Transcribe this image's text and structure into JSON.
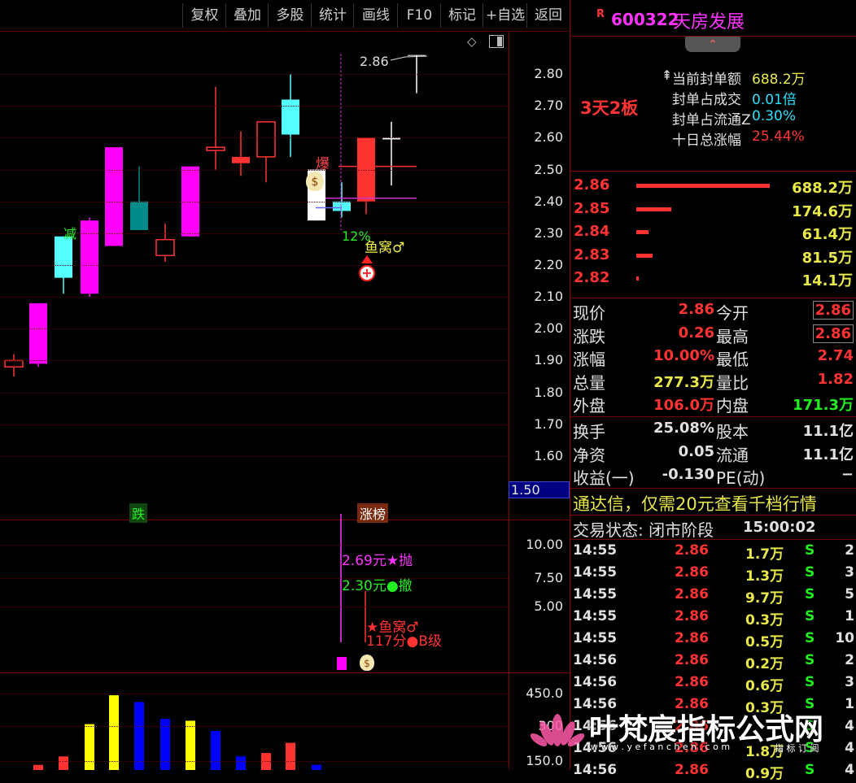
{
  "toolbar": {
    "buttons": [
      "复权",
      "叠加",
      "多股",
      "统计",
      "画线",
      "F10",
      "标记",
      "+自选",
      "返回"
    ]
  },
  "header": {
    "badge": "R",
    "code": "600322",
    "name": "天房发展",
    "collapse_glyph": "⌃"
  },
  "board_label": "3天2板",
  "seal_stats": [
    {
      "label": "当前封单额",
      "value": "688.2万",
      "prefix": "⇞"
    },
    {
      "label": "封单占成交",
      "value": "0.01倍"
    },
    {
      "label": "封单占流通Z",
      "value": "0.30%"
    },
    {
      "label": "十日总涨幅",
      "value": "25.44%"
    }
  ],
  "order_book": [
    {
      "price": "2.86",
      "volume": "688.2万",
      "bar": 1.0
    },
    {
      "price": "2.85",
      "volume": "174.6万",
      "bar": 0.26
    },
    {
      "price": "2.84",
      "volume": "61.4万",
      "bar": 0.09
    },
    {
      "price": "2.83",
      "volume": "81.5万",
      "bar": 0.12
    },
    {
      "price": "2.82",
      "volume": "14.1万",
      "bar": 0.02
    }
  ],
  "quote": [
    {
      "l1": "现价",
      "v1": "2.86",
      "c1": "red",
      "l2": "今开",
      "v2": "2.86",
      "c2": "red",
      "boxed": true
    },
    {
      "l1": "涨跌",
      "v1": "0.26",
      "c1": "red",
      "l2": "最高",
      "v2": "2.86",
      "c2": "red",
      "boxed": true
    },
    {
      "l1": "涨幅",
      "v1": "10.00%",
      "c1": "red",
      "l2": "最低",
      "v2": "2.74",
      "c2": "red",
      "boxed": false
    },
    {
      "l1": "总量",
      "v1": "277.3万",
      "c1": "yel",
      "l2": "量比",
      "v2": "1.82",
      "c2": "red",
      "boxed": false
    },
    {
      "l1": "外盘",
      "v1": "106.0万",
      "c1": "red",
      "l2": "内盘",
      "v2": "171.3万",
      "c2": "grn",
      "boxed": false
    }
  ],
  "fundamentals": [
    {
      "l1": "换手",
      "v1": "25.08%",
      "l2": "股本",
      "v2": "11.1亿"
    },
    {
      "l1": "净资",
      "v1": "0.05",
      "l2": "流通",
      "v2": "11.1亿"
    },
    {
      "l1": "收益(一)",
      "v1": "-0.130",
      "l2": "PE(动)",
      "v2": "−"
    }
  ],
  "promo": "通达信，仅需20元查看千档行情",
  "trade_status": {
    "label": "交易状态: 闭市阶段",
    "time": "15:00:02"
  },
  "ticks": [
    {
      "t": "14:55",
      "p": "2.86",
      "v": "1.7万",
      "s": "S",
      "n": "2"
    },
    {
      "t": "14:55",
      "p": "2.86",
      "v": "1.3万",
      "s": "S",
      "n": "3"
    },
    {
      "t": "14:55",
      "p": "2.86",
      "v": "9.7万",
      "s": "S",
      "n": "5"
    },
    {
      "t": "14:55",
      "p": "2.86",
      "v": "0.3万",
      "s": "S",
      "n": "1"
    },
    {
      "t": "14:55",
      "p": "2.86",
      "v": "0.5万",
      "s": "S",
      "n": "10"
    },
    {
      "t": "14:56",
      "p": "2.86",
      "v": "0.2万",
      "s": "S",
      "n": "2"
    },
    {
      "t": "14:56",
      "p": "2.86",
      "v": "0.6万",
      "s": "S",
      "n": "3"
    },
    {
      "t": "14:56",
      "p": "2.86",
      "v": "0.3万",
      "s": "S",
      "n": "1"
    },
    {
      "t": "14:56",
      "p": "2.86",
      "v": "",
      "s": "S",
      "n": "4"
    },
    {
      "t": "14:56",
      "p": "2.86",
      "v": "1.8万",
      "s": "S",
      "n": "4"
    },
    {
      "t": "14:56",
      "p": "2.86",
      "v": "0.9万",
      "s": "S",
      "n": "4"
    }
  ],
  "price_axis": [
    "2.80",
    "2.70",
    "2.60",
    "2.50",
    "2.40",
    "2.30",
    "2.20",
    "2.10",
    "2.00",
    "1.90",
    "1.80",
    "1.70",
    "1.60"
  ],
  "price_axis_box": "1.50",
  "indicator_axis": [
    "10.00",
    "7.50",
    "5.00"
  ],
  "volume_axis": [
    "450.0",
    "300",
    "150.0"
  ],
  "chart_labels": {
    "peak": "2.86",
    "bao": "爆",
    "jian": "减",
    "pct": "12%",
    "yuwo": "鱼窝♂",
    "die_tag": "跌",
    "zhangbang_tag": "涨榜",
    "ind_sell": "2.69元★抛",
    "ind_cancel": "2.30元●撤",
    "ind_yuwo": "★鱼窝♂",
    "ind_score": "117分●B级"
  },
  "watermark": {
    "title": "叶梵宸指标公式网",
    "url": "w w w . y e f a n c h e n . c o m",
    "sub": "指 标 订 阅"
  },
  "chart_data": {
    "type": "candlestick",
    "y_range": [
      1.5,
      2.9
    ],
    "candles": [
      {
        "o": 1.88,
        "h": 1.92,
        "l": 1.85,
        "c": 1.9,
        "color": "red"
      },
      {
        "o": 1.89,
        "h": 2.08,
        "l": 1.88,
        "c": 2.08,
        "color": "magenta"
      },
      {
        "o": 2.16,
        "h": 2.29,
        "l": 2.11,
        "c": 2.29,
        "color": "cyan"
      },
      {
        "o": 2.11,
        "h": 2.35,
        "l": 2.1,
        "c": 2.34,
        "color": "magenta"
      },
      {
        "o": 2.26,
        "h": 2.57,
        "l": 2.26,
        "c": 2.57,
        "color": "magenta"
      },
      {
        "o": 2.4,
        "h": 2.51,
        "l": 2.36,
        "c": 2.31,
        "color": "teal"
      },
      {
        "o": 2.23,
        "h": 2.33,
        "l": 2.21,
        "c": 2.28,
        "color": "red"
      },
      {
        "o": 2.29,
        "h": 2.51,
        "l": 2.29,
        "c": 2.51,
        "color": "magenta"
      },
      {
        "o": 2.56,
        "h": 2.76,
        "l": 2.5,
        "c": 2.57,
        "color": "red"
      },
      {
        "o": 2.54,
        "h": 2.62,
        "l": 2.48,
        "c": 2.52,
        "color": "red"
      },
      {
        "o": 2.54,
        "h": 2.64,
        "l": 2.46,
        "c": 2.65,
        "color": "red"
      },
      {
        "o": 2.61,
        "h": 2.8,
        "l": 2.54,
        "c": 2.72,
        "color": "cyan"
      },
      {
        "o": 2.5,
        "h": 2.5,
        "l": 2.34,
        "c": 2.34,
        "color": "white"
      },
      {
        "o": 2.37,
        "h": 2.46,
        "l": 2.35,
        "c": 2.4,
        "color": "cyan"
      },
      {
        "o": 2.4,
        "h": 2.6,
        "l": 2.36,
        "c": 2.6,
        "color": "red"
      },
      {
        "o": 2.6,
        "h": 2.65,
        "l": 2.45,
        "c": 2.6,
        "color": "white"
      },
      {
        "o": 2.86,
        "h": 2.86,
        "l": 2.74,
        "c": 2.86,
        "color": "white"
      }
    ],
    "volume": [
      {
        "v": 30,
        "color": "red"
      },
      {
        "v": 80,
        "color": "red"
      },
      {
        "v": 270,
        "color": "yellow"
      },
      {
        "v": 440,
        "color": "yellow"
      },
      {
        "v": 400,
        "color": "blue"
      },
      {
        "v": 300,
        "color": "blue"
      },
      {
        "v": 290,
        "color": "yellow"
      },
      {
        "v": 230,
        "color": "blue"
      },
      {
        "v": 80,
        "color": "blue"
      },
      {
        "v": 100,
        "color": "red"
      },
      {
        "v": 160,
        "color": "red"
      },
      {
        "v": 30,
        "color": "blue"
      }
    ]
  }
}
